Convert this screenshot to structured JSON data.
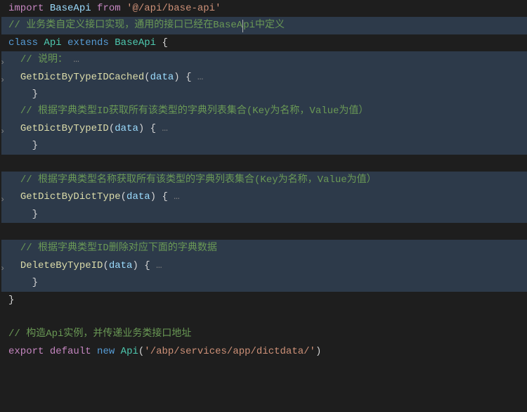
{
  "code": {
    "line1": {
      "import": "import",
      "baseApi": "BaseApi",
      "from": "from",
      "path": "'@/api/base-api'"
    },
    "line2_comment": "// 业务类自定义接口实现，通用的接口已经在BaseA",
    "line2_comment_end": "pi中定义",
    "line3": {
      "class": "class",
      "api": "Api",
      "extends": "extends",
      "baseApi": "BaseApi",
      "brace": "{"
    },
    "line4_comment": "// 说明：",
    "line4_dots": "…",
    "method1": {
      "name": "GetDictByTypeIDCached",
      "param": "data",
      "openBrace": "{",
      "dots": "…",
      "closeBrace": "}"
    },
    "comment2": "// 根据字典类型ID获取所有该类型的字典列表集合(Key为名称，Value为值）",
    "method2": {
      "name": "GetDictByTypeID",
      "param": "data",
      "openBrace": "{",
      "dots": "…",
      "closeBrace": "}"
    },
    "comment3": "// 根据字典类型名称获取所有该类型的字典列表集合(Key为名称，Value为值）",
    "method3": {
      "name": "GetDictByDictType",
      "param": "data",
      "openBrace": "{",
      "dots": "…",
      "closeBrace": "}"
    },
    "comment4": "// 根据字典类型ID删除对应下面的字典数据",
    "method4": {
      "name": "DeleteByTypeID",
      "param": "data",
      "openBrace": "{",
      "dots": "…",
      "closeBrace": "}"
    },
    "closeClass": "}",
    "comment5": "// 构造Api实例，并传递业务类接口地址",
    "export": {
      "export": "export",
      "default": "default",
      "new": "new",
      "api": "Api",
      "arg": "'/abp/services/app/dictdata/'"
    }
  }
}
